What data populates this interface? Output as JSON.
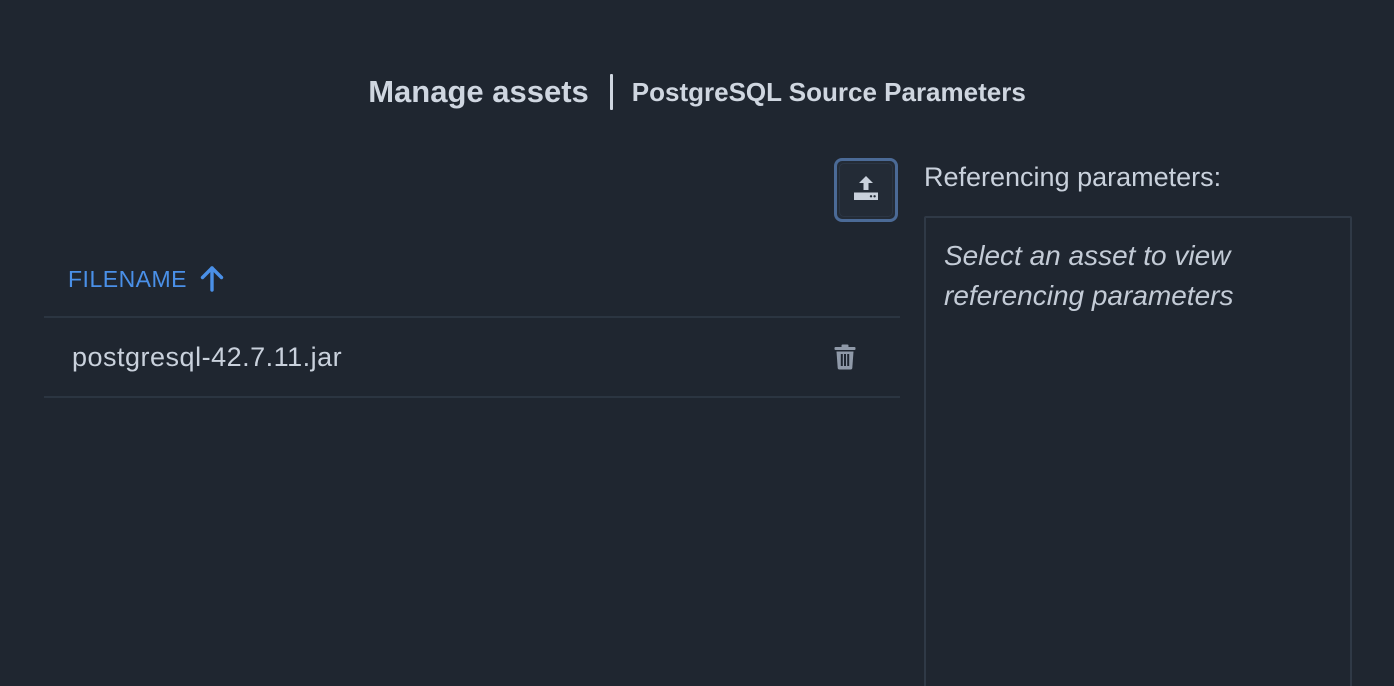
{
  "header": {
    "title": "Manage assets",
    "subtitle": "PostgreSQL Source Parameters"
  },
  "toolbar": {
    "upload_icon": "upload-icon"
  },
  "table": {
    "columns": [
      {
        "label": "FILENAME",
        "sort": "ascending",
        "sort_icon": "arrow-up-icon"
      }
    ],
    "rows": [
      {
        "filename": "postgresql-42.7.11.jar",
        "action_icon": "trash-icon"
      }
    ]
  },
  "references": {
    "label": "Referencing parameters:",
    "placeholder": "Select an asset to view referencing parameters"
  },
  "colors": {
    "background": "#1f2630",
    "accent": "#4a90e8",
    "text": "#c9d1dc",
    "button_border": "#4b6a96",
    "divider": "#2b3541"
  }
}
